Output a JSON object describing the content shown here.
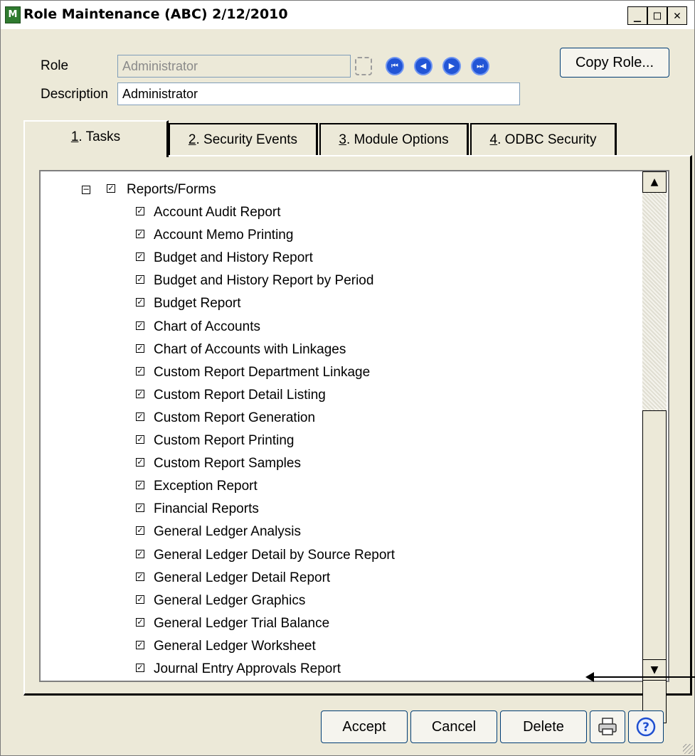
{
  "window": {
    "title": "Role Maintenance (ABC) 2/12/2010",
    "app_icon": "M",
    "controls": {
      "minimize": "_",
      "maximize": "□",
      "close": "✕"
    }
  },
  "form": {
    "role_label": "Role",
    "role_value": "Administrator",
    "description_label": "Description",
    "description_value": "Administrator",
    "copy_role_button": "Copy Role..."
  },
  "navigation": [
    "first",
    "previous",
    "next",
    "last"
  ],
  "tabs": [
    {
      "num": "1",
      "label": ". Tasks",
      "active": true
    },
    {
      "num": "2",
      "label": ". Security Events",
      "active": false
    },
    {
      "num": "3",
      "label": ". Module Options",
      "active": false
    },
    {
      "num": "4",
      "label": ". ODBC Security",
      "active": false
    }
  ],
  "tree": {
    "parent": {
      "label": "Reports/Forms",
      "checked": true,
      "expanded": true
    },
    "items": [
      "Account Audit Report",
      "Account Memo Printing",
      "Budget and History Report",
      "Budget and History Report by Period",
      "Budget Report",
      "Chart of Accounts",
      "Chart of Accounts with Linkages",
      "Custom Report Department Linkage",
      "Custom Report Detail Listing",
      "Custom Report Generation",
      "Custom Report Printing",
      "Custom Report Samples",
      "Exception Report",
      "Financial Reports",
      "General Ledger Analysis",
      "General Ledger Detail by Source Report",
      "General Ledger Detail Report",
      "General Ledger Graphics",
      "General Ledger Trial Balance",
      "General Ledger Worksheet",
      "Journal Entry Approvals Report"
    ]
  },
  "buttons": {
    "accept": "Accept",
    "cancel": "Cancel",
    "delete": "Delete"
  },
  "icons": {
    "print": "printer-icon",
    "help": "help-icon"
  }
}
